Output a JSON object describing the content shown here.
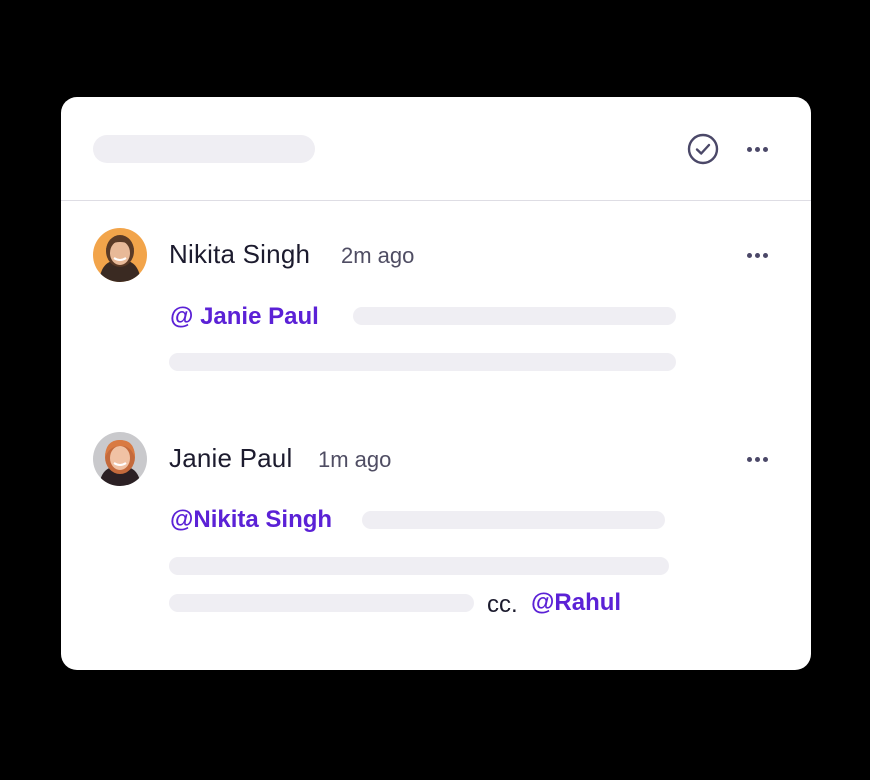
{
  "thread": {
    "comments": [
      {
        "author": "Nikita Singh",
        "time": "2m ago",
        "mention": "@ Janie Paul"
      },
      {
        "author": "Janie Paul",
        "time": "1m ago",
        "mention": "@Nikita Singh",
        "cc_label": "cc.",
        "cc_mention": "@Rahul"
      }
    ]
  },
  "colors": {
    "mention": "#5b21d6",
    "skeleton": "#efeef3",
    "icon": "#4b4868"
  },
  "icons": {
    "resolve": "check-circle-icon",
    "more": "more-horizontal-icon"
  }
}
